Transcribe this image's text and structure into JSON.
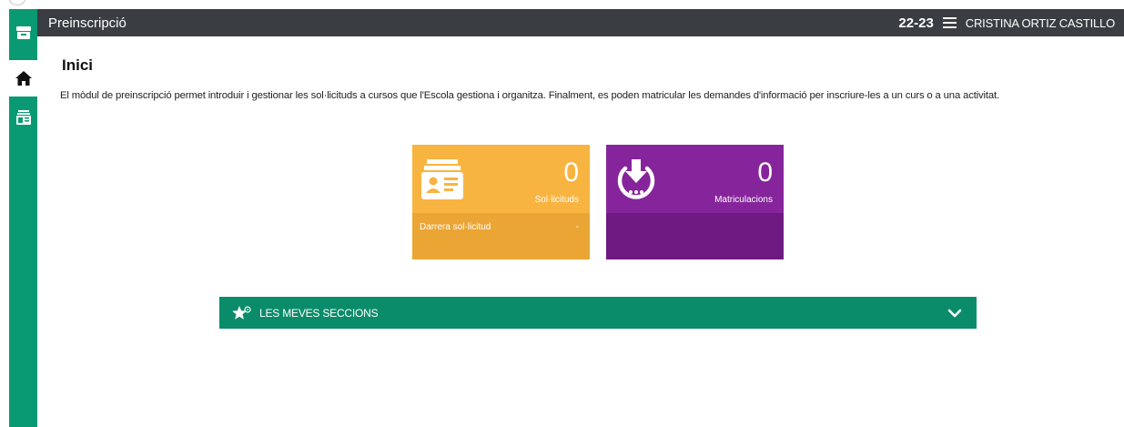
{
  "header": {
    "app_title": "Preinscripció",
    "school_year": "22-23",
    "user_name": "CRISTINA ORTIZ CASTILLO"
  },
  "sidebar": {
    "items": [
      {
        "icon": "archive-box-icon"
      },
      {
        "icon": "home-icon"
      },
      {
        "icon": "id-card-icon"
      }
    ]
  },
  "main": {
    "title": "Inici",
    "description": "El mòdul de preinscripció permet introduir i gestionar les sol·licituds a cursos que l'Escola gestiona i organitza. Finalment, es poden matricular les demandes d'informació per inscriure-les a un curs o a una activitat."
  },
  "tiles": {
    "requests": {
      "count": "0",
      "label": "Sol·licituds",
      "last_label": "Darrera sol·licitud",
      "last_value": "-",
      "color": "#f8b441"
    },
    "enrollments": {
      "count": "0",
      "label": "Matriculacions",
      "color": "#86259b"
    }
  },
  "sections": {
    "label": "LES MEVES SECCIONS",
    "icon": "star-icon",
    "toggle_icon": "chevron-down-icon"
  },
  "colors": {
    "sidebar": "#0a9a73",
    "topbar": "#3a3d42",
    "sections_bar": "#0a8c6a"
  }
}
